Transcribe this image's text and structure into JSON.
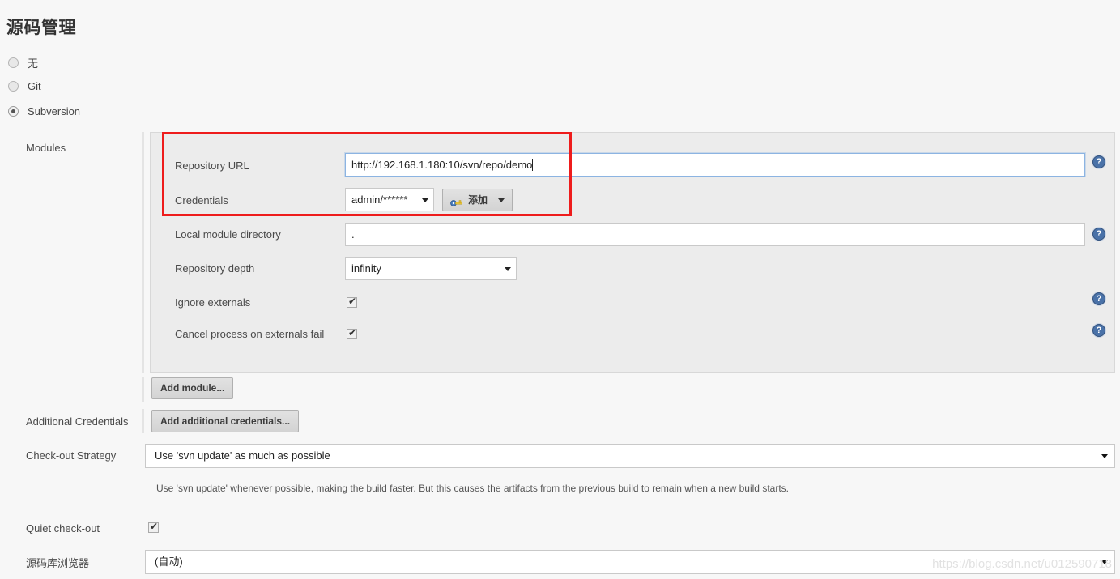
{
  "page": {
    "title": "源码管理",
    "watermark": "https://blog.csdn.net/u012590718"
  },
  "scm_radios": [
    {
      "label": "无",
      "selected": false
    },
    {
      "label": "Git",
      "selected": false
    },
    {
      "label": "Subversion",
      "selected": true
    }
  ],
  "modules": {
    "section_label": "Modules",
    "add_module_button": "Add module...",
    "fields": {
      "repository_url": {
        "label": "Repository URL",
        "value": "http://192.168.1.180:10/svn/repo/demo"
      },
      "credentials": {
        "label": "Credentials",
        "value": "admin/******",
        "add_button": "添加"
      },
      "local_module_directory": {
        "label": "Local module directory",
        "value": "."
      },
      "repository_depth": {
        "label": "Repository depth",
        "value": "infinity"
      },
      "ignore_externals": {
        "label": "Ignore externals",
        "checked": true
      },
      "cancel_process_on_externals_fail": {
        "label": "Cancel process on externals fail",
        "checked": true
      }
    }
  },
  "additional_credentials": {
    "label": "Additional Credentials",
    "button": "Add additional credentials..."
  },
  "checkout_strategy": {
    "label": "Check-out Strategy",
    "value": "Use 'svn update' as much as possible",
    "description": "Use 'svn update' whenever possible, making the build faster. But this causes the artifacts from the previous build to remain when a new build starts."
  },
  "quiet_checkout": {
    "label": "Quiet check-out",
    "checked": true
  },
  "repo_browser": {
    "label": "源码库浏览器",
    "value": "(自动)"
  },
  "help_icon_glyph": "?",
  "colors": {
    "highlight_box": "#ee1c1c",
    "help_icon": "#4a72a8",
    "panel_bg": "#ececec",
    "page_bg": "#f7f7f7"
  }
}
